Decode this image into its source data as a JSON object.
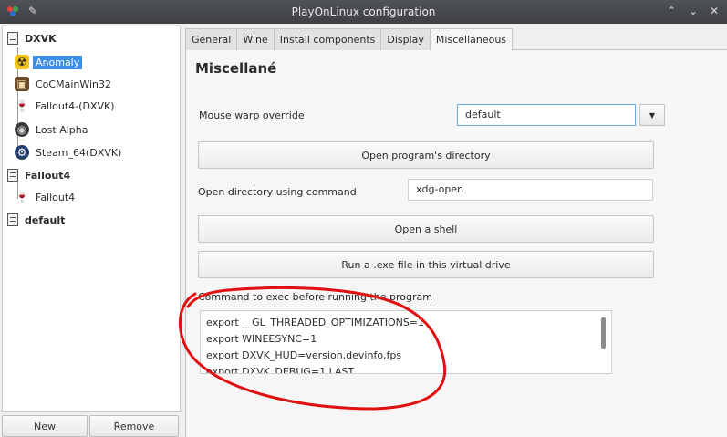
{
  "window": {
    "title": "PlayOnLinux configuration",
    "title_icons": [
      "playonlinux-logo-icon",
      "pin-icon"
    ],
    "controls": [
      "keep-above-icon",
      "minimize-icon",
      "close-icon"
    ]
  },
  "tree": {
    "groups": [
      {
        "label": "DXVK",
        "items": [
          {
            "label": "Anomaly",
            "icon": "radiation-icon",
            "selected": true
          },
          {
            "label": "CoCMainWin32",
            "icon": "game-icon",
            "selected": false
          },
          {
            "label": "Fallout4-(DXVK)",
            "icon": "wine-glass-icon",
            "selected": false
          },
          {
            "label": "Lost Alpha",
            "icon": "globe-icon",
            "selected": false
          },
          {
            "label": "Steam_64(DXVK)",
            "icon": "steam-icon",
            "selected": false
          }
        ]
      },
      {
        "label": "Fallout4",
        "items": [
          {
            "label": "Fallout4",
            "icon": "wine-glass-icon",
            "selected": false
          }
        ]
      },
      {
        "label": "default",
        "items": []
      }
    ],
    "new_button": "New",
    "remove_button": "Remove"
  },
  "tabs": [
    "General",
    "Wine",
    "Install components",
    "Display",
    "Miscellaneous"
  ],
  "active_tab": "Miscellaneous",
  "misc": {
    "section_title": "Miscellané",
    "mouse_warp_label": "Mouse warp override",
    "mouse_warp_value": "default",
    "open_dir_button": "Open program's directory",
    "open_cmd_label": "Open directory using command",
    "open_cmd_value": "xdg-open",
    "shell_button": "Open a shell",
    "run_exe_button": "Run a .exe file in this virtual drive",
    "command_label": "Command to exec before running the program",
    "command_lines": [
      "export __GL_THREADED_OPTIMIZATIONS=1",
      "export WINEESYNC=1",
      "export DXVK_HUD=version,devinfo,fps",
      "export DXVK_DEBUG=1 LAST"
    ]
  },
  "annotation_color": "#e01010"
}
